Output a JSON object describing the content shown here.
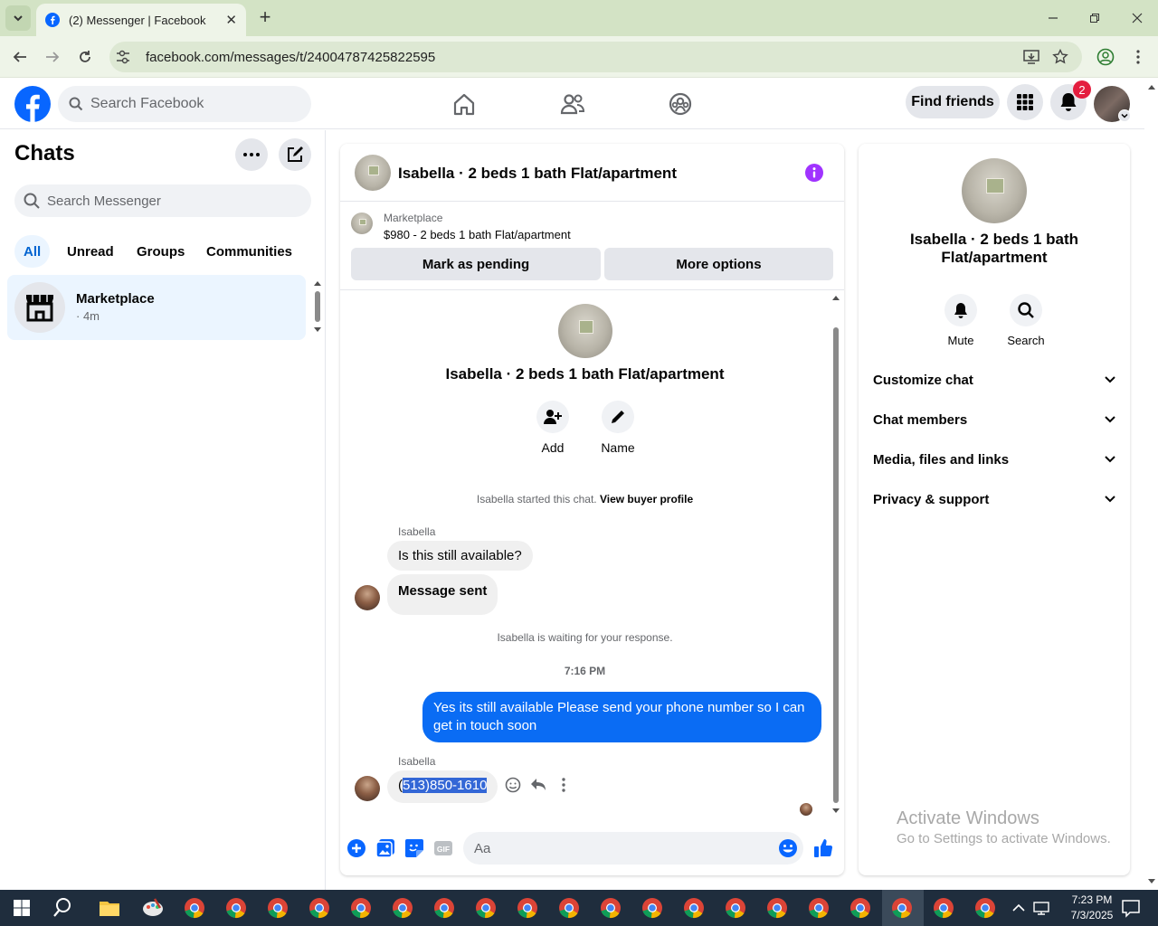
{
  "browser": {
    "tab_title": "(2) Messenger | Facebook",
    "url": "facebook.com/messages/t/24004787425822595"
  },
  "header": {
    "search_placeholder": "Search Facebook",
    "find_friends": "Find friends",
    "notification_count": "2"
  },
  "chats_panel": {
    "title": "Chats",
    "search_placeholder": "Search Messenger",
    "filters": [
      "All",
      "Unread",
      "Groups",
      "Communities"
    ],
    "active_filter": "All",
    "items": [
      {
        "name": "Marketplace",
        "time": "· 4m"
      }
    ]
  },
  "conversation": {
    "title": "Isabella · 2 beds 1 bath Flat/apartment",
    "marketplace_label": "Marketplace",
    "listing": "$980 - 2 beds 1 bath Flat/apartment",
    "mark_pending": "Mark as pending",
    "more_options": "More options",
    "intro_title": "Isabella · 2 beds 1 bath Flat/apartment",
    "actions": [
      {
        "label": "Add",
        "icon": "add-person-icon"
      },
      {
        "label": "Name",
        "icon": "pencil-icon"
      }
    ],
    "started_text": "Isabella started this chat.",
    "buyer_profile_link": "View buyer profile",
    "sender": "Isabella",
    "msg1": "Is this still available?",
    "msg2": "Message sent",
    "waiting_text": "Isabella is waiting for your response.",
    "timestamp": "7:16 PM",
    "outgoing": "Yes its still available Please send your phone number so I can get in touch soon",
    "sender2": "Isabella",
    "phone_prefix": "(",
    "phone_selected": "513)850-1610",
    "composer_placeholder": "Aa"
  },
  "info_panel": {
    "title": "Isabella · 2 beds 1 bath Flat/apartment",
    "mute": "Mute",
    "search": "Search",
    "sections": [
      "Customize chat",
      "Chat members",
      "Media, files and links",
      "Privacy & support"
    ]
  },
  "watermark": {
    "line1": "Activate Windows",
    "line2": "Go to Settings to activate Windows."
  },
  "taskbar": {
    "time": "7:23 PM",
    "date": "7/3/2025"
  },
  "colors": {
    "brand": "#0866ff",
    "accent_purple": "#a033ff",
    "outgoing_bubble": "#0a6cf4",
    "notification_badge": "#e41e3f"
  }
}
